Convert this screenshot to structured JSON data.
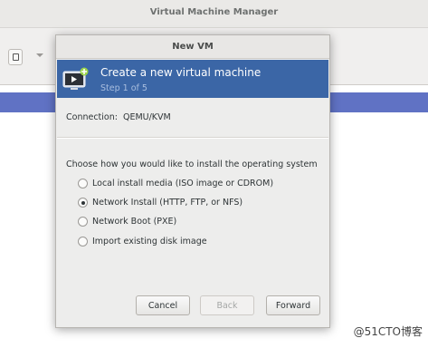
{
  "background_window": {
    "title": "Virtual Machine Manager"
  },
  "dialog": {
    "title": "New VM",
    "banner": {
      "title": "Create a new virtual machine",
      "step": "Step 1 of 5",
      "icon": "monitor-play-icon"
    },
    "connection": {
      "label": "Connection:",
      "value": "QEMU/KVM"
    },
    "question": "Choose how you would like to install the operating system",
    "options": [
      {
        "label": "Local install media (ISO image or CDROM)",
        "checked": false
      },
      {
        "label": "Network Install (HTTP, FTP, or NFS)",
        "checked": true
      },
      {
        "label": "Network Boot (PXE)",
        "checked": false
      },
      {
        "label": "Import existing disk image",
        "checked": false
      }
    ],
    "buttons": {
      "cancel": "Cancel",
      "back": "Back",
      "forward": "Forward"
    }
  },
  "watermark": "@51CTO博客",
  "colors": {
    "banner": "#3b66a6",
    "selection": "#6072c4"
  }
}
